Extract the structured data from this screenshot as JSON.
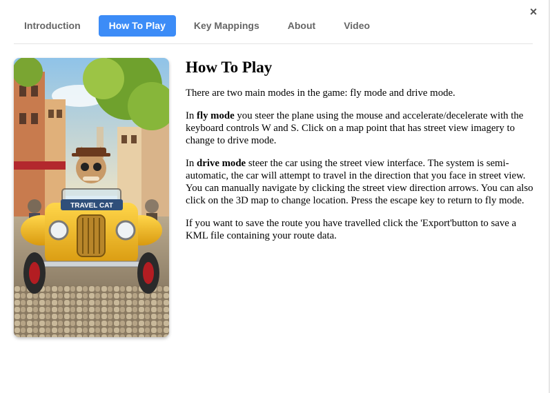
{
  "dialog": {
    "close_icon": "close-icon",
    "close_glyph": "×"
  },
  "tabs": [
    {
      "label": "Introduction",
      "active": false
    },
    {
      "label": "How To Play",
      "active": true
    },
    {
      "label": "Key Mappings",
      "active": false
    },
    {
      "label": "About",
      "active": false
    },
    {
      "label": "Video",
      "active": false
    }
  ],
  "hero_image": {
    "depicts": "cat-driving-yellow-vintage-car",
    "badge_text": "TRAVEL CAT"
  },
  "content": {
    "heading": "How To Play",
    "intro": "There are two main modes in the game: fly mode and drive mode.",
    "fly": {
      "prefix": "In ",
      "bold": "fly mode",
      "text": " you steer the plane using the mouse and accelerate/decelerate with the keyboard controls W and S. Click on a map point that has street view imagery to change to drive mode."
    },
    "drive": {
      "prefix": "In ",
      "bold": "drive mode",
      "text": " steer the car using the street view interface. The system is semi-automatic, the car will attempt to travel in the direction that you face in street view. You can manually navigate by clicking the street view direction arrows. You can also click on the 3D map to change location. Press the escape key to return to fly mode."
    },
    "export": "If you want to save the route you have travelled click the 'Export'button to save a KML file containing your route data."
  },
  "colors": {
    "active_tab": "#3c8cf7",
    "tab_text": "#666666",
    "divider": "#e3e3e3"
  }
}
